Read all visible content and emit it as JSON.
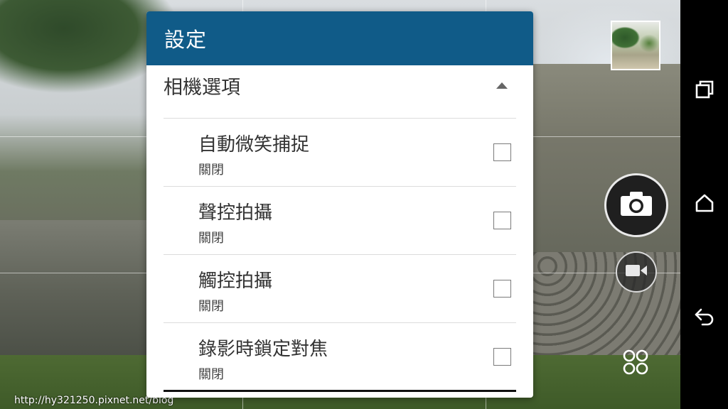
{
  "dialog": {
    "title": "設定",
    "section": {
      "title": "相機選項",
      "expanded": true
    },
    "items": [
      {
        "label": "自動微笑捕捉",
        "value": "關閉",
        "checked": false
      },
      {
        "label": "聲控拍攝",
        "value": "關閉",
        "checked": false
      },
      {
        "label": "觸控拍攝",
        "value": "關閉",
        "checked": false
      },
      {
        "label": "錄影時鎖定對焦",
        "value": "關閉",
        "checked": false
      }
    ]
  },
  "watermark": "http://hy321250.pixnet.net/blog",
  "controls": {
    "icons": [
      "gallery-thumbnail",
      "camera-icon",
      "video-camera-icon",
      "modes-icon"
    ]
  },
  "navbar": {
    "icons": [
      "recent-apps-icon",
      "home-icon",
      "back-icon"
    ]
  },
  "colors": {
    "header": "#105b88",
    "divider": "#dcdcdc"
  }
}
